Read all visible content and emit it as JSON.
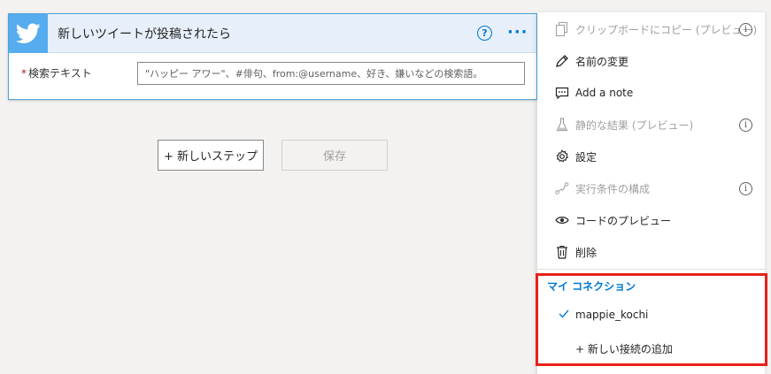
{
  "trigger": {
    "title": "新しいツイートが投稿されたら",
    "help": "?",
    "more": "···",
    "field": {
      "required_mark": "*",
      "label": "検索テキスト",
      "placeholder": "\"ハッピー アワー\"、#俳句、from:@username、好き、嫌いなどの検索語。"
    }
  },
  "buttons": {
    "new_step": "+ 新しいステップ",
    "save": "保存"
  },
  "menu": {
    "items": [
      {
        "label": "クリップボードにコピー (プレビュー)",
        "icon": "copy-icon",
        "disabled": true,
        "info": true
      },
      {
        "label": "名前の変更",
        "icon": "pencil-icon",
        "disabled": false,
        "info": false
      },
      {
        "label": "Add a note",
        "icon": "note-icon",
        "disabled": false,
        "info": false
      },
      {
        "label": "静的な結果 (プレビュー)",
        "icon": "flask-icon",
        "disabled": true,
        "info": true
      },
      {
        "label": "設定",
        "icon": "gear-icon",
        "disabled": false,
        "info": false
      },
      {
        "label": "実行条件の構成",
        "icon": "run-after-icon",
        "disabled": true,
        "info": true
      },
      {
        "label": "コードのプレビュー",
        "icon": "eye-icon",
        "disabled": false,
        "info": false
      },
      {
        "label": "削除",
        "icon": "trash-icon",
        "disabled": false,
        "info": false
      }
    ],
    "info_glyph": "i",
    "connections": {
      "header": "マイ コネクション",
      "current": "mappie_kochi",
      "add": "+ 新しい接続の追加"
    }
  },
  "colors": {
    "accent": "#0078d4",
    "twitter": "#55acee",
    "highlight": "#e8211a"
  }
}
